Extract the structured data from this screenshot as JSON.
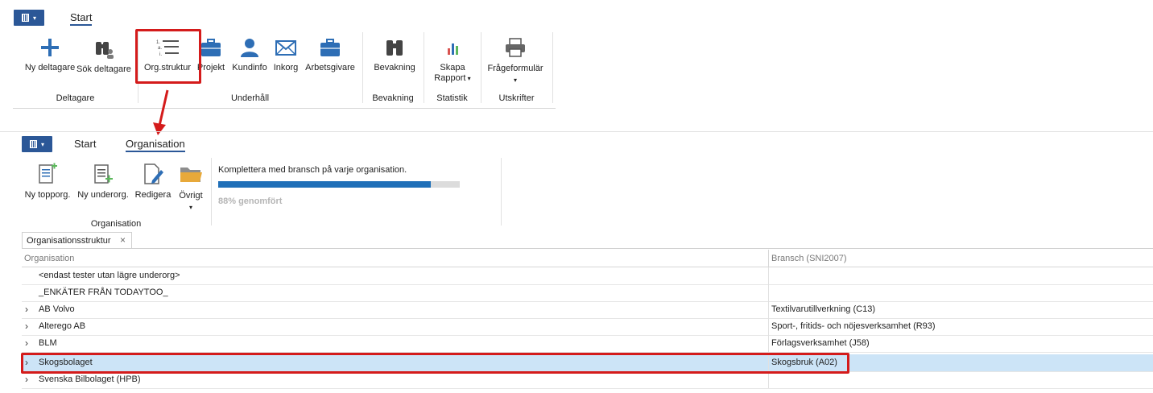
{
  "top_ribbon": {
    "tab_start": "Start",
    "buttons": {
      "ny_deltagare": "Ny deltagare",
      "sok_deltagare": "Sök deltagare",
      "org_struktur": "Org.struktur",
      "projekt": "Projekt",
      "kundinfo": "Kundinfo",
      "inkorg": "Inkorg",
      "arbetsgivare": "Arbetsgivare",
      "bevakning": "Bevakning",
      "skapa_rapport_line1": "Skapa",
      "skapa_rapport_line2": "Rapport",
      "frageformular": "Frågeformulär"
    },
    "groups": {
      "deltagare": "Deltagare",
      "underhall": "Underhåll",
      "bevakning": "Bevakning",
      "statistik": "Statistik",
      "utskrifter": "Utskrifter"
    }
  },
  "bottom_ribbon": {
    "tab_start": "Start",
    "tab_organisation": "Organisation",
    "buttons": {
      "ny_topporg": "Ny topporg.",
      "ny_underorg": "Ny underorg.",
      "redigera": "Redigera",
      "ovrigt": "Övrigt"
    },
    "group_organisation": "Organisation",
    "progress": {
      "message": "Komplettera med bransch på varje organisation.",
      "percent": 88,
      "label": "88% genomfört"
    }
  },
  "document_tab": {
    "title": "Organisationsstruktur",
    "close": "×"
  },
  "grid": {
    "columns": [
      "Organisation",
      "Bransch (SNI2007)"
    ],
    "rows": [
      {
        "name": "<endast tester utan lägre underorg>",
        "bransch": "",
        "expandable": false
      },
      {
        "name": "_ENKÄTER FRÅN TODAYTOO_",
        "bransch": "",
        "expandable": false
      },
      {
        "name": "AB Volvo",
        "bransch": "Textilvarutillverkning (C13)",
        "expandable": true
      },
      {
        "name": "Alterego AB",
        "bransch": "Sport-, fritids- och nöjesverksamhet (R93)",
        "expandable": true
      },
      {
        "name": "BLM",
        "bransch": "Förlagsverksamhet (J58)",
        "expandable": true
      },
      {
        "name": "Skogsbolaget",
        "bransch": "Skogsbruk (A02)",
        "expandable": true
      },
      {
        "name": "Svenska Bilbolaget (HPB)",
        "bransch": "",
        "expandable": true
      }
    ]
  },
  "colors": {
    "accent": "#2b5797",
    "icon_blue": "#2e6eb5",
    "highlight_red": "#d41b1b",
    "selected_row": "#cce4f7",
    "progress_fill": "#1f6fb8",
    "progress_track": "#dcdcdc"
  }
}
